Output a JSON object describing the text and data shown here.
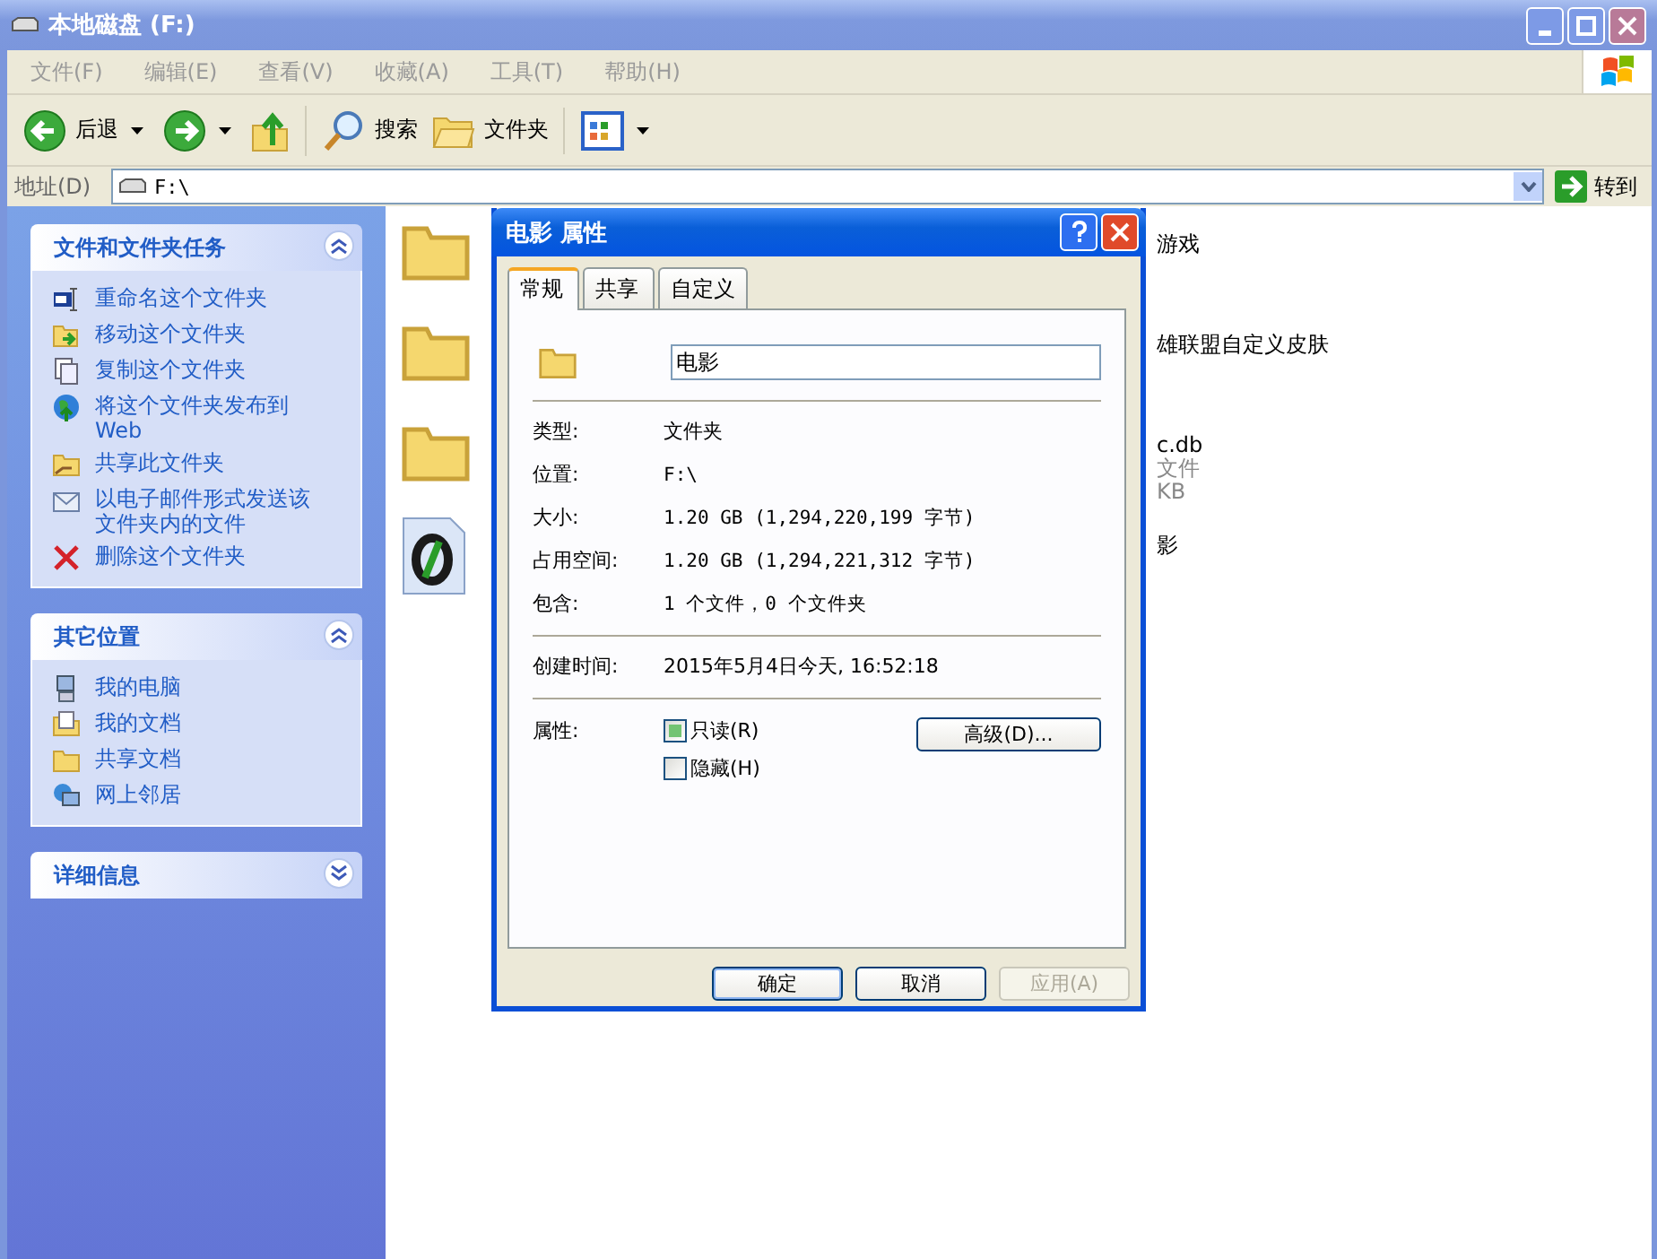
{
  "window": {
    "title": "本地磁盘 (F:)"
  },
  "menu": [
    "文件(F)",
    "编辑(E)",
    "查看(V)",
    "收藏(A)",
    "工具(T)",
    "帮助(H)"
  ],
  "toolbar": [
    {
      "kind": "back",
      "label": "后退"
    },
    {
      "kind": "forward"
    },
    {
      "kind": "up"
    },
    {
      "kind": "search",
      "label": "搜索"
    },
    {
      "kind": "folders",
      "label": "文件夹"
    },
    {
      "kind": "views"
    }
  ],
  "address": {
    "label": "地址(D)",
    "value": "F:\\",
    "go": "转到"
  },
  "sidebar": [
    {
      "title": "文件和文件夹任务",
      "expanded": true,
      "items": [
        {
          "label": "重命名这个文件夹"
        },
        {
          "label": "移动这个文件夹"
        },
        {
          "label": "复制这个文件夹"
        },
        {
          "label": "将这个文件夹发布到 Web"
        },
        {
          "label": "共享此文件夹"
        },
        {
          "label": "以电子邮件形式发送该文件夹内的文件"
        },
        {
          "label": "删除这个文件夹"
        }
      ]
    },
    {
      "title": "其它位置",
      "expanded": true,
      "items": [
        {
          "label": "我的电脑"
        },
        {
          "label": "我的文档"
        },
        {
          "label": "共享文档"
        },
        {
          "label": "网上邻居"
        }
      ]
    },
    {
      "title": "详细信息",
      "expanded": false
    }
  ],
  "files": [
    {
      "kind": "folder",
      "lines": [
        "游戏"
      ]
    },
    {
      "kind": "folder",
      "lines": [
        "雄联盟自定义皮肤"
      ]
    },
    {
      "kind": "folder",
      "lines": [
        "c.db",
        "文件",
        "KB"
      ]
    },
    {
      "kind": "document",
      "lines": [
        "影"
      ]
    }
  ],
  "dialog": {
    "title": "电影 属性",
    "tabs": [
      {
        "label": "常规",
        "selected": true
      },
      {
        "label": "共享",
        "selected": false
      },
      {
        "label": "自定义",
        "selected": false
      }
    ],
    "name": "电影",
    "properties": [
      {
        "label": "类型:",
        "value": "文件夹"
      },
      {
        "label": "位置:",
        "value": "F:\\"
      },
      {
        "label": "大小:",
        "value": "1.20 GB (1,294,220,199 字节)"
      },
      {
        "label": "占用空间:",
        "value": "1.20 GB (1,294,221,312 字节)"
      },
      {
        "label": "包含:",
        "value": "1 个文件，0 个文件夹"
      }
    ],
    "created": {
      "label": "创建时间:",
      "value": "2015年5月4日今天, 16:52:18"
    },
    "attributes_label": "属性:",
    "attributes": [
      {
        "label": "只读(R)",
        "mixed": true
      },
      {
        "label": "隐藏(H)",
        "mixed": false
      }
    ],
    "advanced": "高级(D)...",
    "buttons": [
      {
        "label": "确定",
        "default": true,
        "disabled": false
      },
      {
        "label": "取消",
        "default": false,
        "disabled": false
      },
      {
        "label": "应用(A)",
        "default": false,
        "disabled": true
      }
    ]
  }
}
